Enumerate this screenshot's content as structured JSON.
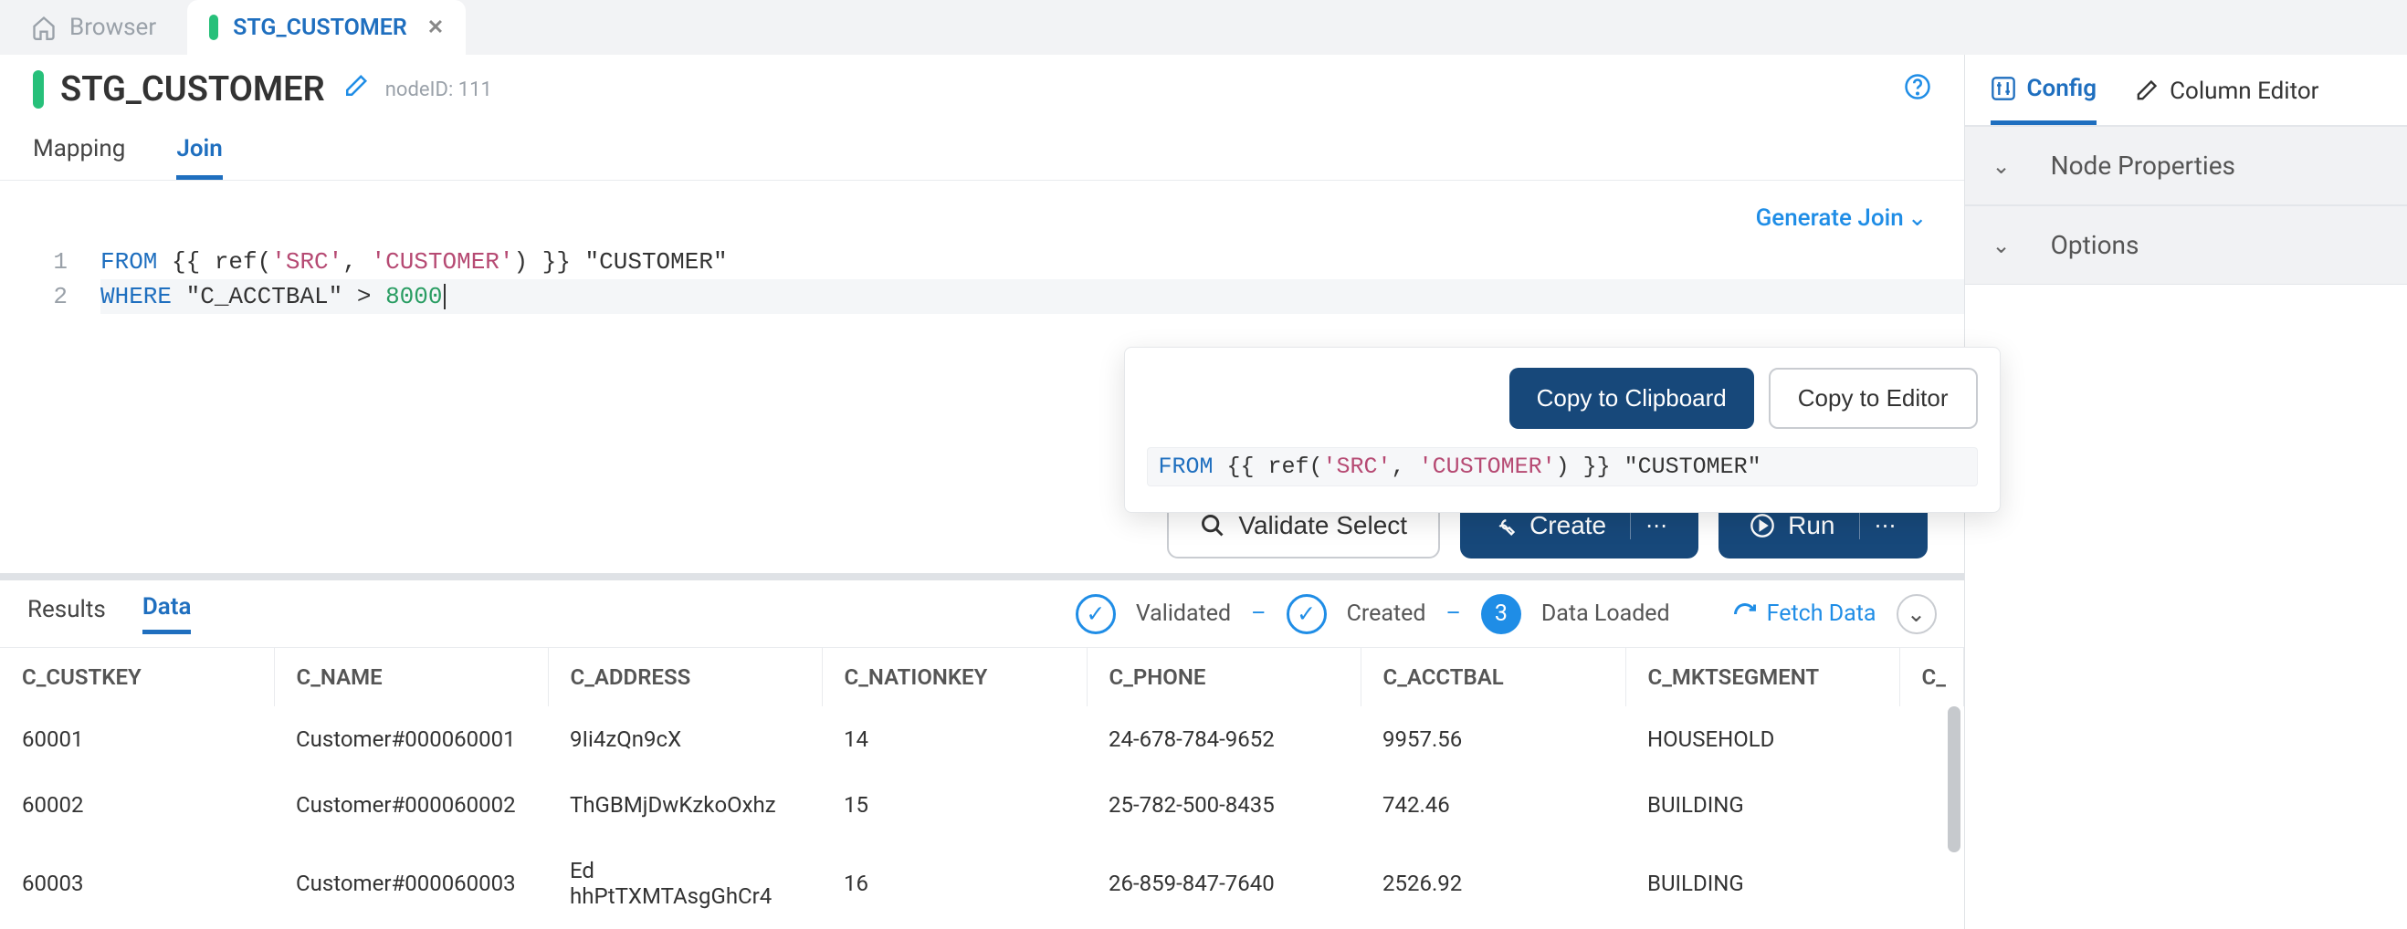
{
  "tabs": {
    "browser": "Browser",
    "active": "STG_CUSTOMER"
  },
  "header": {
    "title": "STG_CUSTOMER",
    "node_id": "nodeID: 111"
  },
  "subtabs": {
    "mapping": "Mapping",
    "join": "Join"
  },
  "editor": {
    "generate_join": "Generate Join",
    "line1_gutter": "1",
    "line2_gutter": "2",
    "l1_from": "FROM",
    "l1_open": " {{ ref(",
    "l1_src": "'SRC'",
    "l1_sep": ", ",
    "l1_cust": "'CUSTOMER'",
    "l1_close": ") }} ",
    "l1_alias": "\"CUSTOMER\"",
    "l2_where": "WHERE",
    "l2_col": " \"C_ACCTBAL\" ",
    "l2_gt": "> ",
    "l2_val": "8000"
  },
  "popover": {
    "copy_clip": "Copy to Clipboard",
    "copy_editor": "Copy to Editor",
    "p_from": "FROM",
    "p_open": " {{ ref(",
    "p_src": "'SRC'",
    "p_sep": ", ",
    "p_cust": "'CUSTOMER'",
    "p_close": ") }} ",
    "p_alias": "\"CUSTOMER\""
  },
  "actions": {
    "validate": "Validate Select",
    "create": "Create",
    "run": "Run"
  },
  "results": {
    "results_tab": "Results",
    "data_tab": "Data",
    "validated": "Validated",
    "created": "Created",
    "step3": "3",
    "loaded": "Data Loaded",
    "fetch": "Fetch Data"
  },
  "table": {
    "headers": [
      "C_CUSTKEY",
      "C_NAME",
      "C_ADDRESS",
      "C_NATIONKEY",
      "C_PHONE",
      "C_ACCTBAL",
      "C_MKTSEGMENT",
      "C_"
    ],
    "rows": [
      [
        "60001",
        "Customer#000060001",
        "9Ii4zQn9cX",
        "14",
        "24-678-784-9652",
        "9957.56",
        "HOUSEHOLD",
        ""
      ],
      [
        "60002",
        "Customer#000060002",
        "ThGBMjDwKzkoOxhz",
        "15",
        "25-782-500-8435",
        "742.46",
        "BUILDING",
        ""
      ],
      [
        "60003",
        "Customer#000060003",
        "Ed hhPtTXMTAsgGhCr4",
        "16",
        "26-859-847-7640",
        "2526.92",
        "BUILDING",
        ""
      ]
    ]
  },
  "right": {
    "config": "Config",
    "coleditor": "Column Editor",
    "node_props": "Node Properties",
    "options": "Options"
  }
}
